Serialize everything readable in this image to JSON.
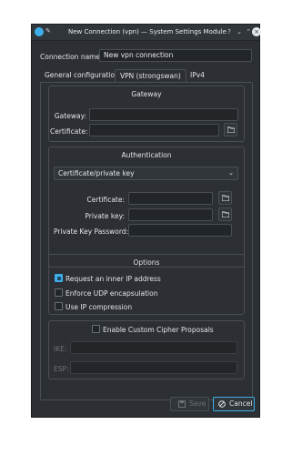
{
  "window": {
    "title": "New Connection (vpn) — System Settings Module"
  },
  "titlebar": {
    "help": "?",
    "minimize": "⌄",
    "maximize": "⌃",
    "close": "×"
  },
  "connection": {
    "label": "Connection name:",
    "value": "New vpn connection"
  },
  "tabs": [
    {
      "label": "General configuration",
      "active": false
    },
    {
      "label": "VPN (strongswan)",
      "active": true
    },
    {
      "label": "IPv4",
      "active": false
    }
  ],
  "gateway": {
    "title": "Gateway",
    "gateway_label": "Gateway:",
    "gateway_value": "",
    "certificate_label": "Certificate:",
    "certificate_value": ""
  },
  "authentication": {
    "title": "Authentication",
    "method": "Certificate/private key",
    "certificate_label": "Certificate:",
    "private_key_label": "Private key:",
    "private_key_password_label": "Private Key Password:"
  },
  "options": {
    "title": "Options",
    "items": [
      {
        "label": "Request an inner IP address",
        "checked": true
      },
      {
        "label": "Enforce UDP encapsulation",
        "checked": false
      },
      {
        "label": "Use IP compression",
        "checked": false
      }
    ]
  },
  "cipher": {
    "enable_label": "Enable Custom Cipher Proposals",
    "enabled": false,
    "ike_label": "IKE:",
    "esp_label": "ESP:"
  },
  "buttons": {
    "save": "Save",
    "cancel": "Cancel"
  },
  "colors": {
    "accent": "#3daee9",
    "background": "#2c2f33",
    "field": "#232629"
  }
}
